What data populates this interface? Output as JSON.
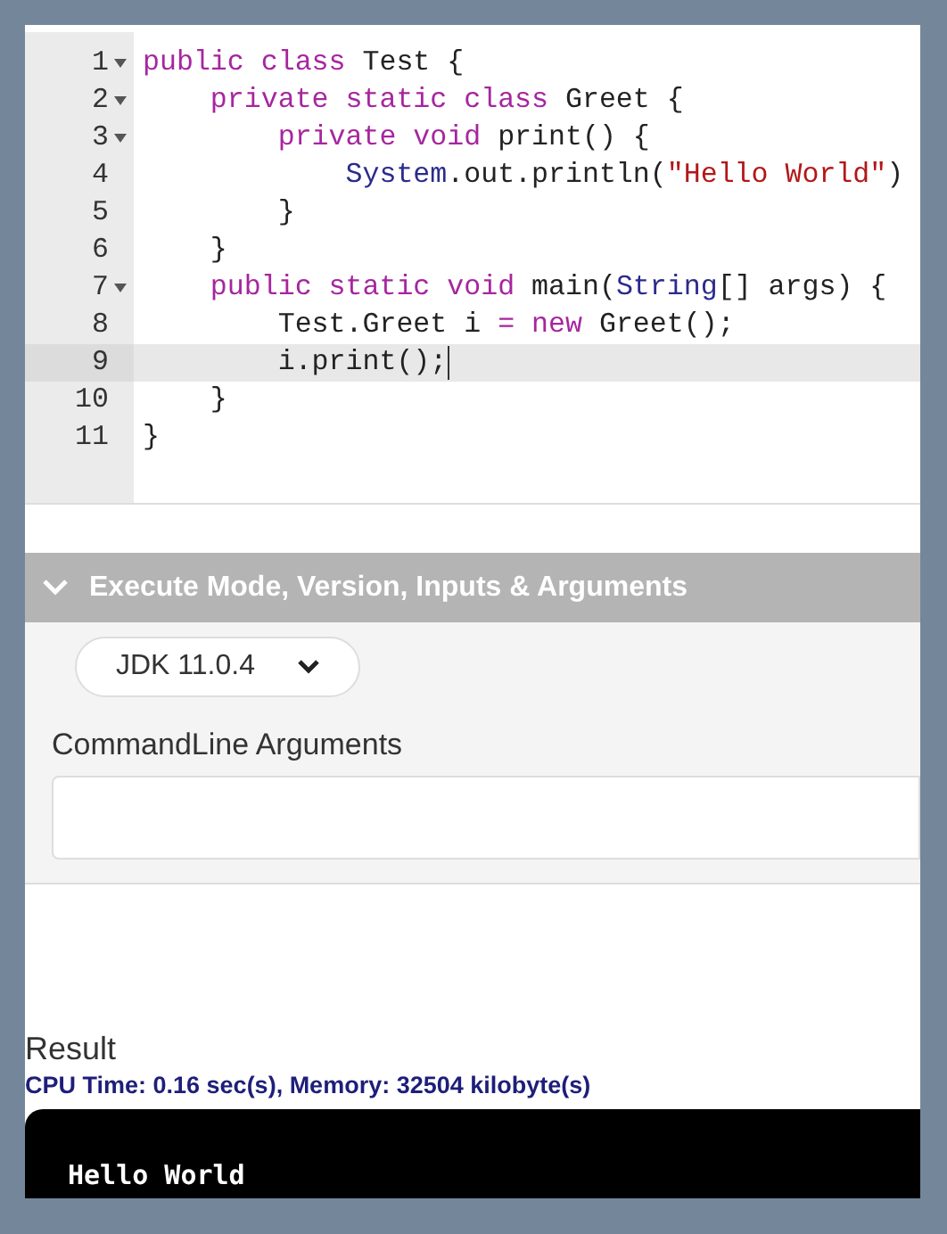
{
  "editor": {
    "lines": [
      {
        "number": "1",
        "fold": true,
        "active": false,
        "tokens": [
          {
            "kind": "keyword",
            "text": "public class"
          },
          {
            "kind": "plain",
            "text": " Test {"
          }
        ]
      },
      {
        "number": "2",
        "fold": true,
        "active": false,
        "tokens": [
          {
            "kind": "keyword",
            "text": "    private static class"
          },
          {
            "kind": "plain",
            "text": " Greet {"
          }
        ]
      },
      {
        "number": "3",
        "fold": true,
        "active": false,
        "tokens": [
          {
            "kind": "keyword",
            "text": "        private void"
          },
          {
            "kind": "plain",
            "text": " print() {"
          }
        ]
      },
      {
        "number": "4",
        "fold": false,
        "active": false,
        "tokens": [
          {
            "kind": "type",
            "text": "            System"
          },
          {
            "kind": "plain",
            "text": ".out.println("
          },
          {
            "kind": "string",
            "text": "\"Hello World\""
          },
          {
            "kind": "plain",
            "text": ")"
          }
        ]
      },
      {
        "number": "5",
        "fold": false,
        "active": false,
        "tokens": [
          {
            "kind": "plain",
            "text": "        }"
          }
        ]
      },
      {
        "number": "6",
        "fold": false,
        "active": false,
        "tokens": [
          {
            "kind": "plain",
            "text": "    }"
          }
        ]
      },
      {
        "number": "7",
        "fold": true,
        "active": false,
        "tokens": [
          {
            "kind": "keyword",
            "text": "    public static void"
          },
          {
            "kind": "plain",
            "text": " main("
          },
          {
            "kind": "type",
            "text": "String"
          },
          {
            "kind": "plain",
            "text": "[] args) {"
          }
        ]
      },
      {
        "number": "8",
        "fold": false,
        "active": false,
        "tokens": [
          {
            "kind": "plain",
            "text": "        Test.Greet i "
          },
          {
            "kind": "keyword",
            "text": "= new"
          },
          {
            "kind": "plain",
            "text": " Greet();"
          }
        ]
      },
      {
        "number": "9",
        "fold": false,
        "active": true,
        "tokens": [
          {
            "kind": "plain",
            "text": "        i.print();"
          }
        ]
      },
      {
        "number": "10",
        "fold": false,
        "active": false,
        "tokens": [
          {
            "kind": "plain",
            "text": "    }"
          }
        ]
      },
      {
        "number": "11",
        "fold": false,
        "active": false,
        "tokens": [
          {
            "kind": "plain",
            "text": "}"
          }
        ]
      }
    ]
  },
  "execute_panel": {
    "title": "Execute Mode, Version, Inputs & Arguments",
    "expanded": true,
    "version": "JDK 11.0.4",
    "arguments_label": "CommandLine Arguments"
  },
  "result": {
    "title": "Result",
    "stats": "CPU Time: 0.16 sec(s), Memory: 32504 kilobyte(s)",
    "output": "Hello World"
  }
}
